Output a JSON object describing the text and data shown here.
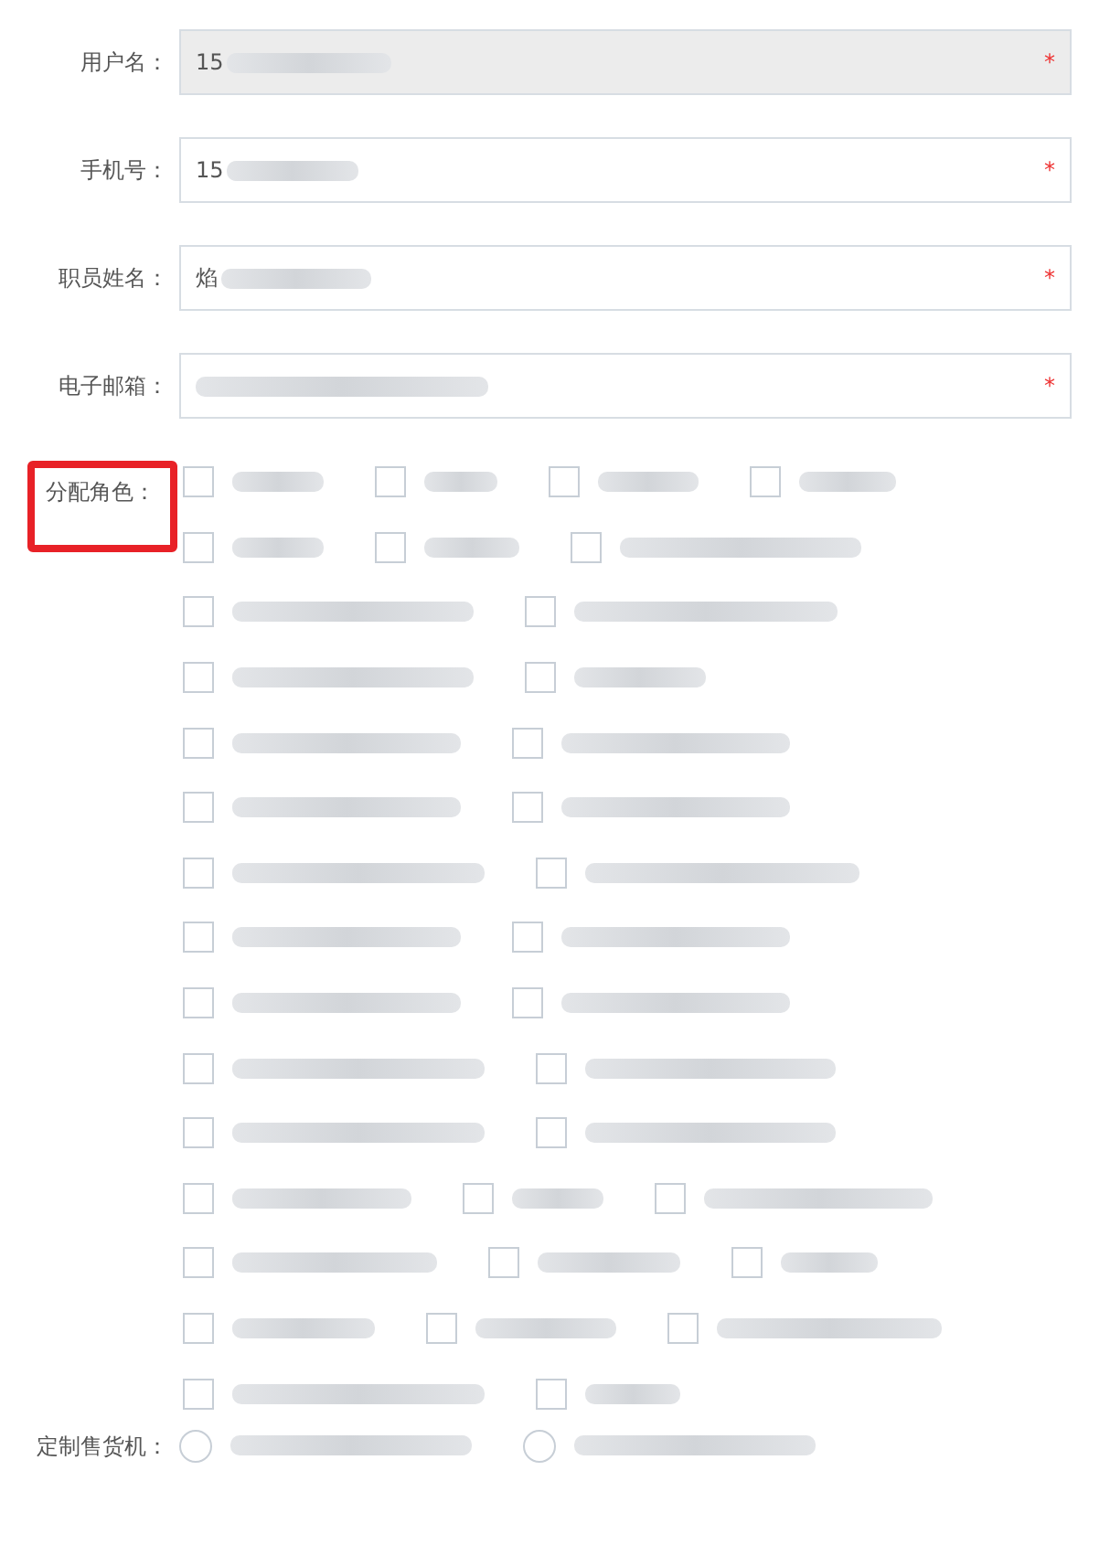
{
  "fields": [
    {
      "label": "用户名：",
      "value": "15",
      "disabled": true,
      "required_mark": "*"
    },
    {
      "label": "手机号：",
      "value": "15",
      "disabled": false,
      "required_mark": "*"
    },
    {
      "label": "职员姓名：",
      "value": "焰",
      "disabled": false,
      "required_mark": "*"
    },
    {
      "label": "电子邮箱：",
      "disabled": false,
      "required_mark": "*"
    }
  ],
  "roles": {
    "label": "分配角色：",
    "highlighted": true,
    "options": [
      [
        {
          "checked": false
        },
        {
          "checked": false
        },
        {
          "checked": false
        },
        {
          "checked": false
        }
      ],
      [
        {
          "checked": false
        },
        {
          "checked": false
        },
        {
          "checked": false
        }
      ],
      [
        {
          "checked": false
        },
        {
          "checked": false
        }
      ],
      [
        {
          "checked": false
        },
        {
          "checked": false
        }
      ],
      [
        {
          "checked": false
        },
        {
          "checked": false
        }
      ],
      [
        {
          "checked": false
        },
        {
          "checked": false
        }
      ],
      [
        {
          "checked": false
        },
        {
          "checked": false
        }
      ],
      [
        {
          "checked": false
        },
        {
          "checked": false
        }
      ],
      [
        {
          "checked": false
        },
        {
          "checked": false
        }
      ],
      [
        {
          "checked": false
        },
        {
          "checked": false
        }
      ],
      [
        {
          "checked": false
        },
        {
          "checked": false
        }
      ],
      [
        {
          "checked": false
        },
        {
          "checked": false
        },
        {
          "checked": false
        }
      ],
      [
        {
          "checked": false
        },
        {
          "checked": false
        },
        {
          "checked": false
        }
      ],
      [
        {
          "checked": false
        },
        {
          "checked": false
        },
        {
          "checked": false
        }
      ],
      [
        {
          "checked": false
        },
        {
          "checked": false
        }
      ]
    ]
  },
  "vending": {
    "label": "定制售货机：",
    "options": [
      {
        "selected": false
      },
      {
        "selected": false
      }
    ]
  }
}
